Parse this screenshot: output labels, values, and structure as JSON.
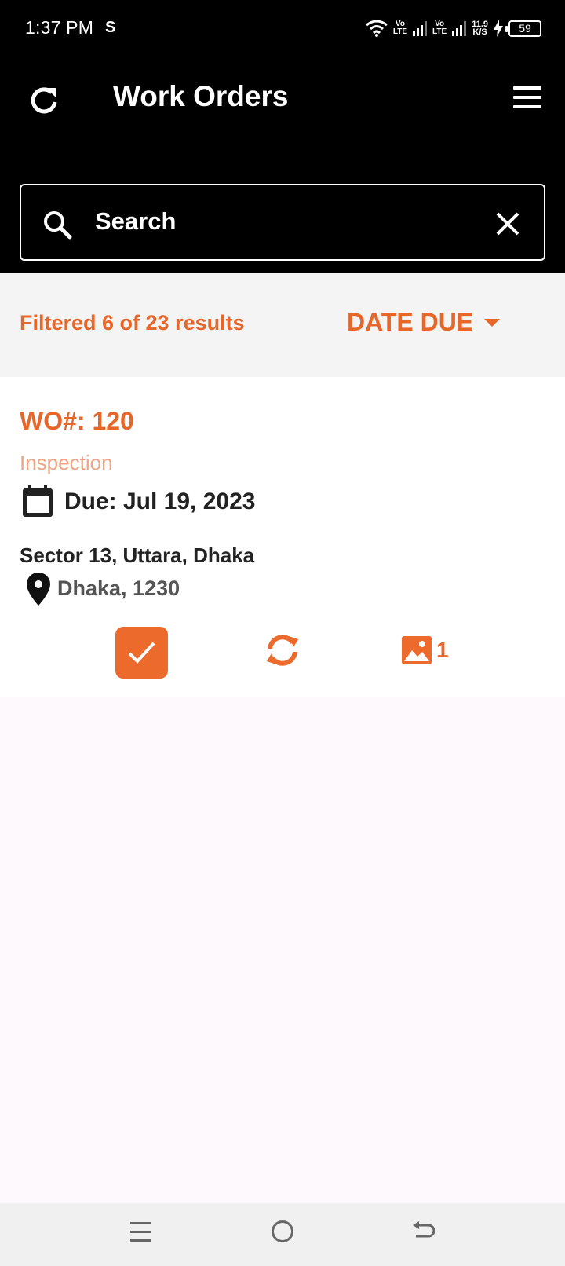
{
  "status_bar": {
    "time": "1:37 PM",
    "sim1_label": "Vo\nLTE",
    "sim2_label": "Vo\nLTE",
    "net_speed": "11.9\nK/S",
    "battery": "59"
  },
  "header": {
    "title": "Work Orders"
  },
  "search": {
    "placeholder": "Search",
    "value": ""
  },
  "filter": {
    "count_text": "Filtered 6 of 23 results",
    "sort_label": "DATE DUE"
  },
  "work_orders": [
    {
      "number": "WO#: 120",
      "type": "Inspection",
      "due": "Due: Jul 19, 2023",
      "address": "Sector 13, Uttara, Dhaka",
      "city": "Dhaka, 1230",
      "image_count": "1"
    }
  ],
  "colors": {
    "accent": "#e7672a",
    "accent_light": "#f0a483",
    "header_bg": "#000000",
    "filter_bg": "#f4f4f4"
  },
  "icons": [
    "refresh-icon",
    "menu-icon",
    "search-icon",
    "close-icon",
    "calendar-icon",
    "location-pin-icon",
    "check-icon",
    "sync-icon",
    "image-icon"
  ]
}
